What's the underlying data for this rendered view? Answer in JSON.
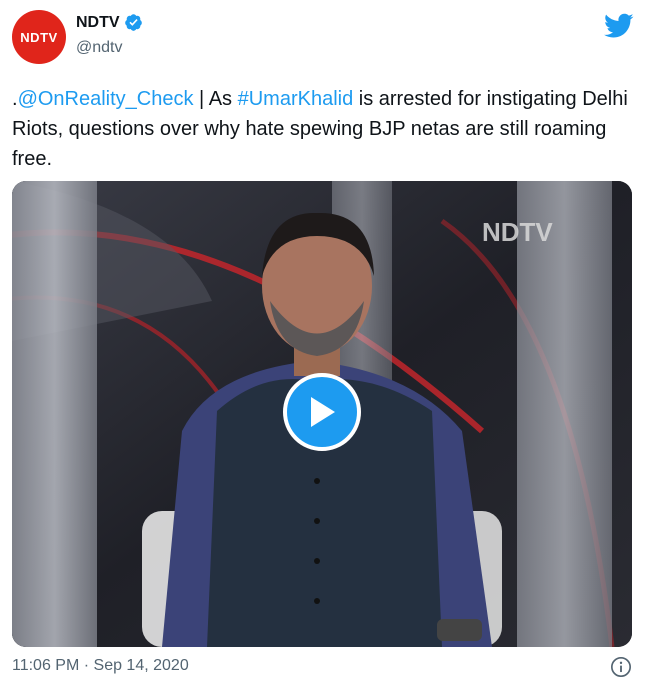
{
  "account": {
    "avatar_text": "NDTV",
    "name": "NDTV",
    "handle": "@ndtv",
    "avatar_color": "#e0251b",
    "verified_icon": "verified-badge-icon",
    "platform_icon": "twitter-bird-icon"
  },
  "tweet": {
    "prefix": ".",
    "mention": "@OnReality_Check",
    "text_part1": " | As ",
    "hashtag": "#UmarKhalid",
    "text_part2": " is arrested for instigating Delhi Riots, questions over why hate spewing BJP netas are still roaming free."
  },
  "media": {
    "type": "video",
    "channel_watermark": "NDTV",
    "play_icon": "play-icon"
  },
  "footer": {
    "timestamp": "11:06 PM · Sep 14, 2020",
    "info_icon": "info-icon"
  },
  "colors": {
    "link": "#1d9bf0",
    "secondary_text": "#536471",
    "brand_red": "#e0251b",
    "play_button": "#1d9bf0"
  }
}
